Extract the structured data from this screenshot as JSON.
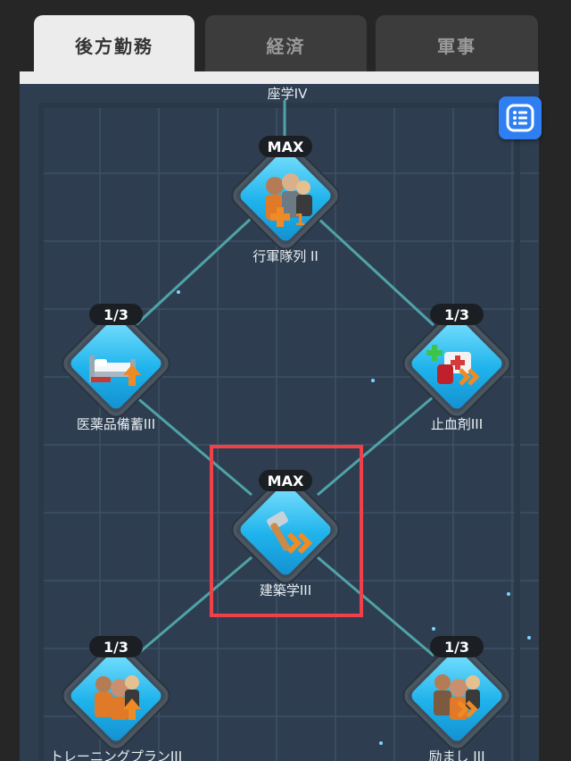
{
  "tabs": [
    {
      "label": "後方勤務",
      "active": true
    },
    {
      "label": "経済",
      "active": false
    },
    {
      "label": "軍事",
      "active": false
    }
  ],
  "tree": {
    "top_label": "座学IV",
    "nodes": [
      {
        "id": "march",
        "badge": "MAX",
        "label": "行軍隊列 II",
        "icon": "soldiers-plus-icon"
      },
      {
        "id": "medical",
        "badge": "1/3",
        "label": "医薬品備蓄III",
        "icon": "hospital-bed-icon"
      },
      {
        "id": "hemostat",
        "badge": "1/3",
        "label": "止血剤III",
        "icon": "medkit-icon"
      },
      {
        "id": "construction",
        "badge": "MAX",
        "label": "建築学III",
        "icon": "hammer-icon"
      },
      {
        "id": "training",
        "badge": "1/3",
        "label": "トレーニングプランIII",
        "icon": "soldiers-up-icon"
      },
      {
        "id": "encourage",
        "badge": "1/3",
        "label": "励まし III",
        "icon": "soldiers-speed-icon"
      }
    ]
  },
  "colors": {
    "board": "#2e3e50",
    "connector": "#4fa3a8",
    "highlight": "#f0404a",
    "tile_blue": "#1fb3ec",
    "accent_orange": "#f08a24"
  },
  "list_button_icon": "list-icon"
}
